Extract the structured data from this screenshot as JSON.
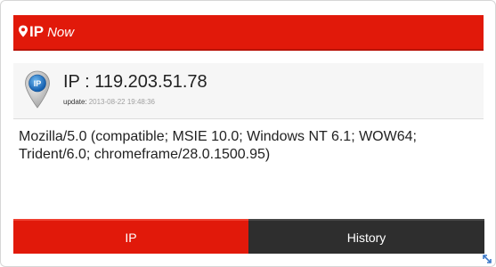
{
  "header": {
    "title_ip": "IP",
    "title_now": "Now"
  },
  "ip_panel": {
    "ip_label": "IP : 119.203.51.78",
    "update_label": "update:",
    "update_time": "2013-08-22 19:48:36"
  },
  "user_agent": "Mozilla/5.0 (compatible; MSIE 10.0; Windows NT 6.1; WOW64; Trident/6.0; chromeframe/28.0.1500.95)",
  "tabs": {
    "ip_label": "IP",
    "history_label": "History"
  },
  "colors": {
    "accent": "#e1190a",
    "dark_tab": "#2e2e2e",
    "marker_blue": "#1e78c8"
  },
  "icons": {
    "logo": "location-pin-icon",
    "marker": "ip-map-marker-icon",
    "resize": "resize-arrow-icon"
  }
}
